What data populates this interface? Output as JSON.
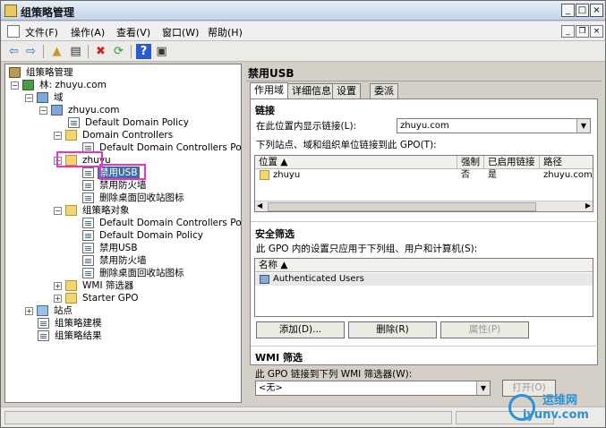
{
  "window": {
    "title": "组策略管理",
    "controls": {
      "minimize": "_",
      "maximize": "□",
      "close": "×"
    }
  },
  "menubar": {
    "items": [
      "文件(F)",
      "操作(A)",
      "查看(V)",
      "窗口(W)",
      "帮助(H)"
    ],
    "mdi_controls": {
      "minimize": "_",
      "restore": "❐",
      "close": "×"
    }
  },
  "toolbar": {
    "icons": [
      "back-icon",
      "forward-icon",
      "up-icon",
      "show-hide-tree-icon",
      "delete-icon",
      "refresh-icon",
      "help-icon",
      "properties-icon"
    ]
  },
  "tree": {
    "root": "组策略管理",
    "forest": "林: zhuyu.com",
    "domains": "域",
    "domain": "zhuyu.com",
    "default_domain_policy": "Default Domain Policy",
    "domain_controllers": "Domain Controllers",
    "default_domain_controllers_policy": "Default Domain Controllers Po",
    "ou": "zhuyu",
    "ou_links": [
      "禁用USB",
      "禁用防火墙",
      "删除桌面回收站图标"
    ],
    "gpo_container": "组策略对象",
    "gpos": [
      "Default Domain Controllers Po",
      "Default Domain Policy",
      "禁用USB",
      "禁用防火墙",
      "删除桌面回收站图标"
    ],
    "wmi_filters": "WMI 筛选器",
    "starter_gpo": "Starter GPO",
    "sites": "站点",
    "modeling": "组策略建模",
    "results": "组策略结果"
  },
  "details": {
    "title": "禁用USB",
    "tabs": [
      "作用域",
      "详细信息",
      "设置",
      "委派"
    ],
    "links": {
      "section": "链接",
      "location_label": "在此位置内显示链接(L):",
      "location_value": "zhuyu.com",
      "linked_label": "下列站点、域和组织单位链接到此 GPO(T):",
      "columns": [
        "位置",
        "强制",
        "已启用链接",
        "路径"
      ],
      "rows": [
        {
          "location": "zhuyu",
          "enforced": "否",
          "enabled": "是",
          "path": "zhuyu.com/z"
        }
      ]
    },
    "security": {
      "section": "安全筛选",
      "label": "此 GPO 内的设置只应用于下列组、用户和计算机(S):",
      "columns": [
        "名称"
      ],
      "rows": [
        "Authenticated Users"
      ],
      "buttons": {
        "add": "添加(D)...",
        "remove": "删除(R)",
        "properties": "属性(P)"
      }
    },
    "wmi": {
      "section": "WMI 筛选",
      "label": "此 GPO 链接到下列 WMI 筛选器(W):",
      "value": "<无>",
      "open_button": "打开(O)"
    }
  },
  "watermark": {
    "line1": "运维网",
    "line2": "iyunv.com"
  }
}
